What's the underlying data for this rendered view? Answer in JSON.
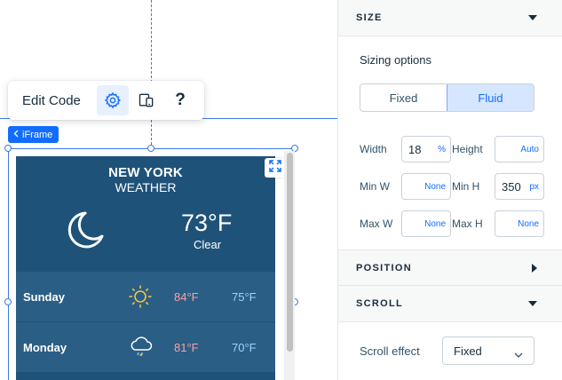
{
  "toolbar": {
    "edit_code_label": "Edit Code",
    "settings_icon": "gear-icon",
    "devices_icon": "devices-icon",
    "help_label": "?"
  },
  "iframe_tag": {
    "label": "iFrame",
    "icon": "chevron-left-icon"
  },
  "widget": {
    "city": "NEW YORK",
    "subtitle": "WEATHER",
    "current_icon": "moon-icon",
    "temperature": "73°F",
    "condition": "Clear",
    "forecast": [
      {
        "day": "Sunday",
        "icon": "sun-icon",
        "high": "84°F",
        "low": "75°F"
      },
      {
        "day": "Monday",
        "icon": "rain-cloud-icon",
        "high": "81°F",
        "low": "70°F"
      }
    ],
    "expand_icon": "expand-icon"
  },
  "panel": {
    "size": {
      "title": "SIZE",
      "sizing_label": "Sizing options",
      "options": [
        "Fixed",
        "Fluid"
      ],
      "selected": "Fluid",
      "width_label": "Width",
      "width_value": "18",
      "width_unit": "%",
      "height_label": "Height",
      "height_unit": "Auto",
      "min_w_label": "Min W",
      "min_w_unit": "None",
      "min_h_label": "Min H",
      "min_h_value": "350",
      "min_h_unit": "px",
      "max_w_label": "Max W",
      "max_w_unit": "None",
      "max_h_label": "Max H",
      "max_h_unit": "None"
    },
    "position": {
      "title": "POSITION"
    },
    "scroll": {
      "title": "SCROLL",
      "effect_label": "Scroll effect",
      "effect_value": "Fixed"
    }
  },
  "colors": {
    "accent": "#116dff",
    "widget_bg": "#1f5279",
    "forecast_row": "#2b5e85",
    "high_temp": "#f5a3a3",
    "low_temp": "#9fd0ff"
  }
}
